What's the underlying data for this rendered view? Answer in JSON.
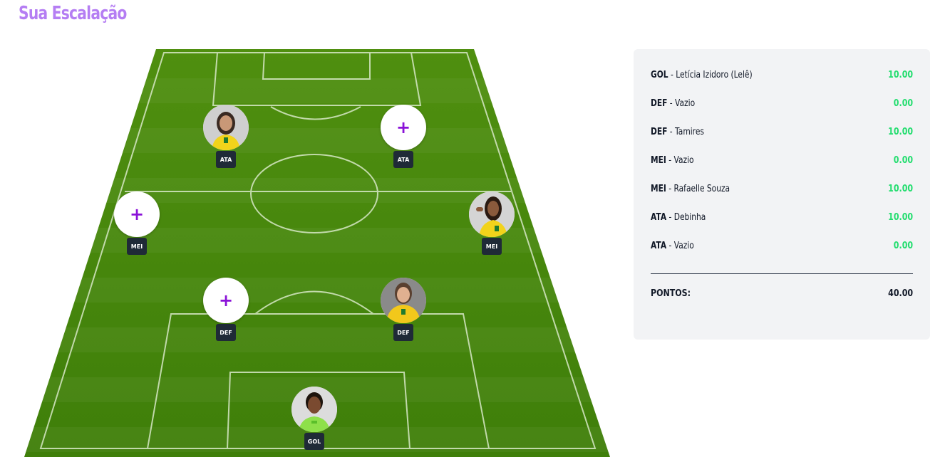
{
  "title": "Sua Escalação",
  "pitch": {
    "grass_color": "#4a8a0c",
    "line_color": "#d7e8c6",
    "slots": [
      {
        "position": "ATA",
        "filled": true,
        "plus": ""
      },
      {
        "position": "ATA",
        "filled": false,
        "plus": "+"
      },
      {
        "position": "MEI",
        "filled": false,
        "plus": "+"
      },
      {
        "position": "MEI",
        "filled": true,
        "plus": ""
      },
      {
        "position": "DEF",
        "filled": false,
        "plus": "+"
      },
      {
        "position": "DEF",
        "filled": true,
        "plus": ""
      },
      {
        "position": "GOL",
        "filled": true,
        "plus": ""
      }
    ]
  },
  "summary": {
    "rows": [
      {
        "pos": "GOL",
        "name": " - Letícia Izidoro (Lelê)",
        "points": "10.00"
      },
      {
        "pos": "DEF",
        "name": " - Vazio",
        "points": "0.00"
      },
      {
        "pos": "DEF",
        "name": " - Tamires",
        "points": "10.00"
      },
      {
        "pos": "MEI",
        "name": " - Vazio",
        "points": "0.00"
      },
      {
        "pos": "MEI",
        "name": " - Rafaelle Souza",
        "points": "10.00"
      },
      {
        "pos": "ATA",
        "name": " - Debinha",
        "points": "10.00"
      },
      {
        "pos": "ATA",
        "name": " - Vazio",
        "points": "0.00"
      }
    ],
    "total_label": "PONTOS:",
    "total_value": "40.00"
  },
  "colors": {
    "title": "#b57ef3",
    "points_positive": "#22dd6e",
    "badge_bg": "#1f2a37",
    "plus": "#8a12d8"
  }
}
